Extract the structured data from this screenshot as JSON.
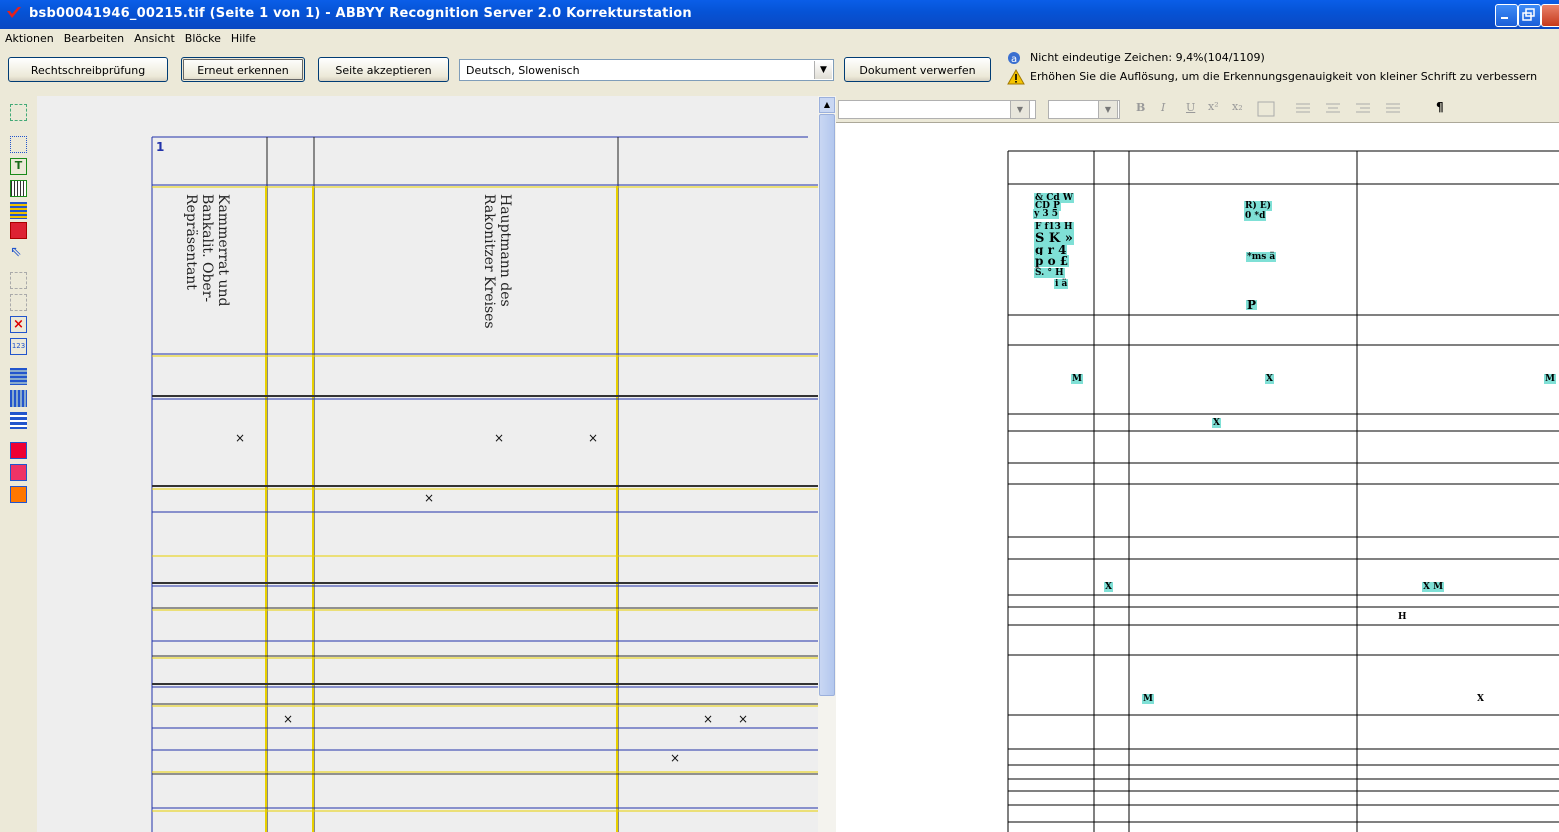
{
  "window": {
    "title": "bsb00041946_00215.tif (Seite 1 von 1) - ABBYY Recognition Server 2.0 Korrekturstation",
    "accent_color": "#0a5ee8"
  },
  "menu": {
    "items": [
      "Aktionen",
      "Bearbeiten",
      "Ansicht",
      "Blöcke",
      "Hilfe"
    ]
  },
  "toolbar": {
    "spellcheck_label": "Rechtschreibprüfung",
    "rerecognize_label": "Erneut erkennen",
    "accept_page_label": "Seite akzeptieren",
    "language_value": "Deutsch, Slowenisch",
    "discard_label": "Dokument verwerfen",
    "status_uncertain": "Nicht eindeutige Zeichen: 9,4%(104/1109)",
    "status_warning": "Erhöhen Sie die Auflösung, um die Erkennungsgenauigkeit von kleiner Schrift zu verbessern"
  },
  "image_pane": {
    "block_number": "1",
    "col1_line1": "Kammerrat und",
    "col1_line2": "Bankalit. Ober-",
    "col1_line3": "Repräsentant",
    "col2_line1": "Hauptmann des",
    "col2_line2": "Rakonitzer Kreises",
    "cross_mark": "×"
  },
  "text_pane": {
    "format_buttons": [
      "B",
      "I",
      "U",
      "x²",
      "x₂",
      "¶"
    ],
    "ocr_fragments": [
      "& Cd W",
      "CD P",
      "y 3 5",
      "F f13 H",
      "S K »",
      "g r 4",
      "p o £",
      "S. ° H",
      "i ä",
      "R) E)",
      "0 *d",
      "*ms ä",
      "P",
      "M",
      "X",
      "M",
      "X",
      "X",
      "X M",
      "H",
      "M",
      "X"
    ]
  }
}
